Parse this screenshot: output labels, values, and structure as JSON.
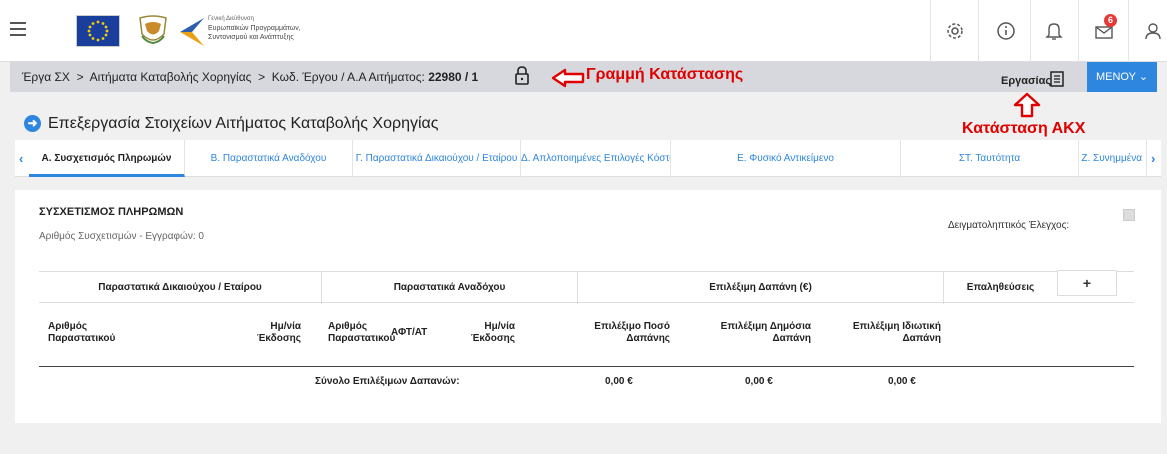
{
  "header": {
    "agency_lines": [
      "Γενική Διεύθυνση",
      "Ευρωπαϊκών Προγραμμάτων,",
      "Συντονισμού και Ανάπτυξης"
    ],
    "notification_count": "6",
    "icons": [
      "menu-icon",
      "settings-icon",
      "info-icon",
      "bell-icon",
      "mail-icon",
      "user-icon"
    ]
  },
  "statusbar": {
    "crumb1": "Έργα ΣΧ",
    "sep": ">",
    "crumb2": "Αιτήματα Καταβολής Χορηγίας",
    "crumb3_prefix": "Κωδ. Έργου / Α.Α Αιτήματος:",
    "crumb3_value": "22980 / 1",
    "status_callout": "Γραμμή Κατάστασης",
    "state_label": "Εργασίας",
    "menu_label": "ΜΕΝΟΥ",
    "akx_callout": "Κατάσταση ΑΚΧ"
  },
  "page": {
    "title": "Επεξεργασία Στοιχείων Αιτήματος Καταβολής Χορηγίας"
  },
  "tabs": [
    {
      "label": "Α. Συσχετισμός Πληρωμών"
    },
    {
      "label": "Β. Παραστατικά Αναδόχου"
    },
    {
      "label": "Γ. Παραστατικά Δικαιούχου / Εταίρου"
    },
    {
      "label": "Δ. Απλοποιημένες Επιλογές Κόστους"
    },
    {
      "label": "Ε. Φυσικό Αντικείμενο"
    },
    {
      "label": "ΣΤ. Ταυτότητα"
    },
    {
      "label": "Ζ. Συνημμένα"
    }
  ],
  "section": {
    "title": "ΣΥΣΧΕΤΙΣΜΟΣ ΠΛΗΡΩΜΩΝ",
    "subtitle": "Αριθμός Συσχετισμών - Εγγραφών: 0",
    "sample_label": "Δειγματοληπτικός Έλεγχος:",
    "groups": {
      "g1": "Παραστατικά Δικαιούχου / Εταίρου",
      "g2": "Παραστατικά Αναδόχου",
      "g3": "Επιλέξιμη Δαπάνη (€)",
      "g4": "Επαληθεύσεις"
    },
    "plus": "+",
    "columns": {
      "c1a": "Αριθμός",
      "c1b": "Παραστατικού",
      "c2a": "Ημ/νία",
      "c2b": "Έκδοσης",
      "c3a": "Αριθμός",
      "c3b": "Παραστατικού",
      "c4": "ΑΦΤ/ΑΤ",
      "c5a": "Ημ/νία",
      "c5b": "Έκδοσης",
      "c6a": "Επιλέξιμο Ποσό",
      "c6b": "Δαπάνης",
      "c7a": "Επιλέξιμη Δημόσια",
      "c7b": "Δαπάνη",
      "c8a": "Επιλέξιμη Ιδιωτική",
      "c8b": "Δαπάνη"
    },
    "total_label": "Σύνολο Επιλέξιμων Δαπανών:",
    "totals": [
      "0,00 €",
      "0,00 €",
      "0,00 €"
    ]
  }
}
